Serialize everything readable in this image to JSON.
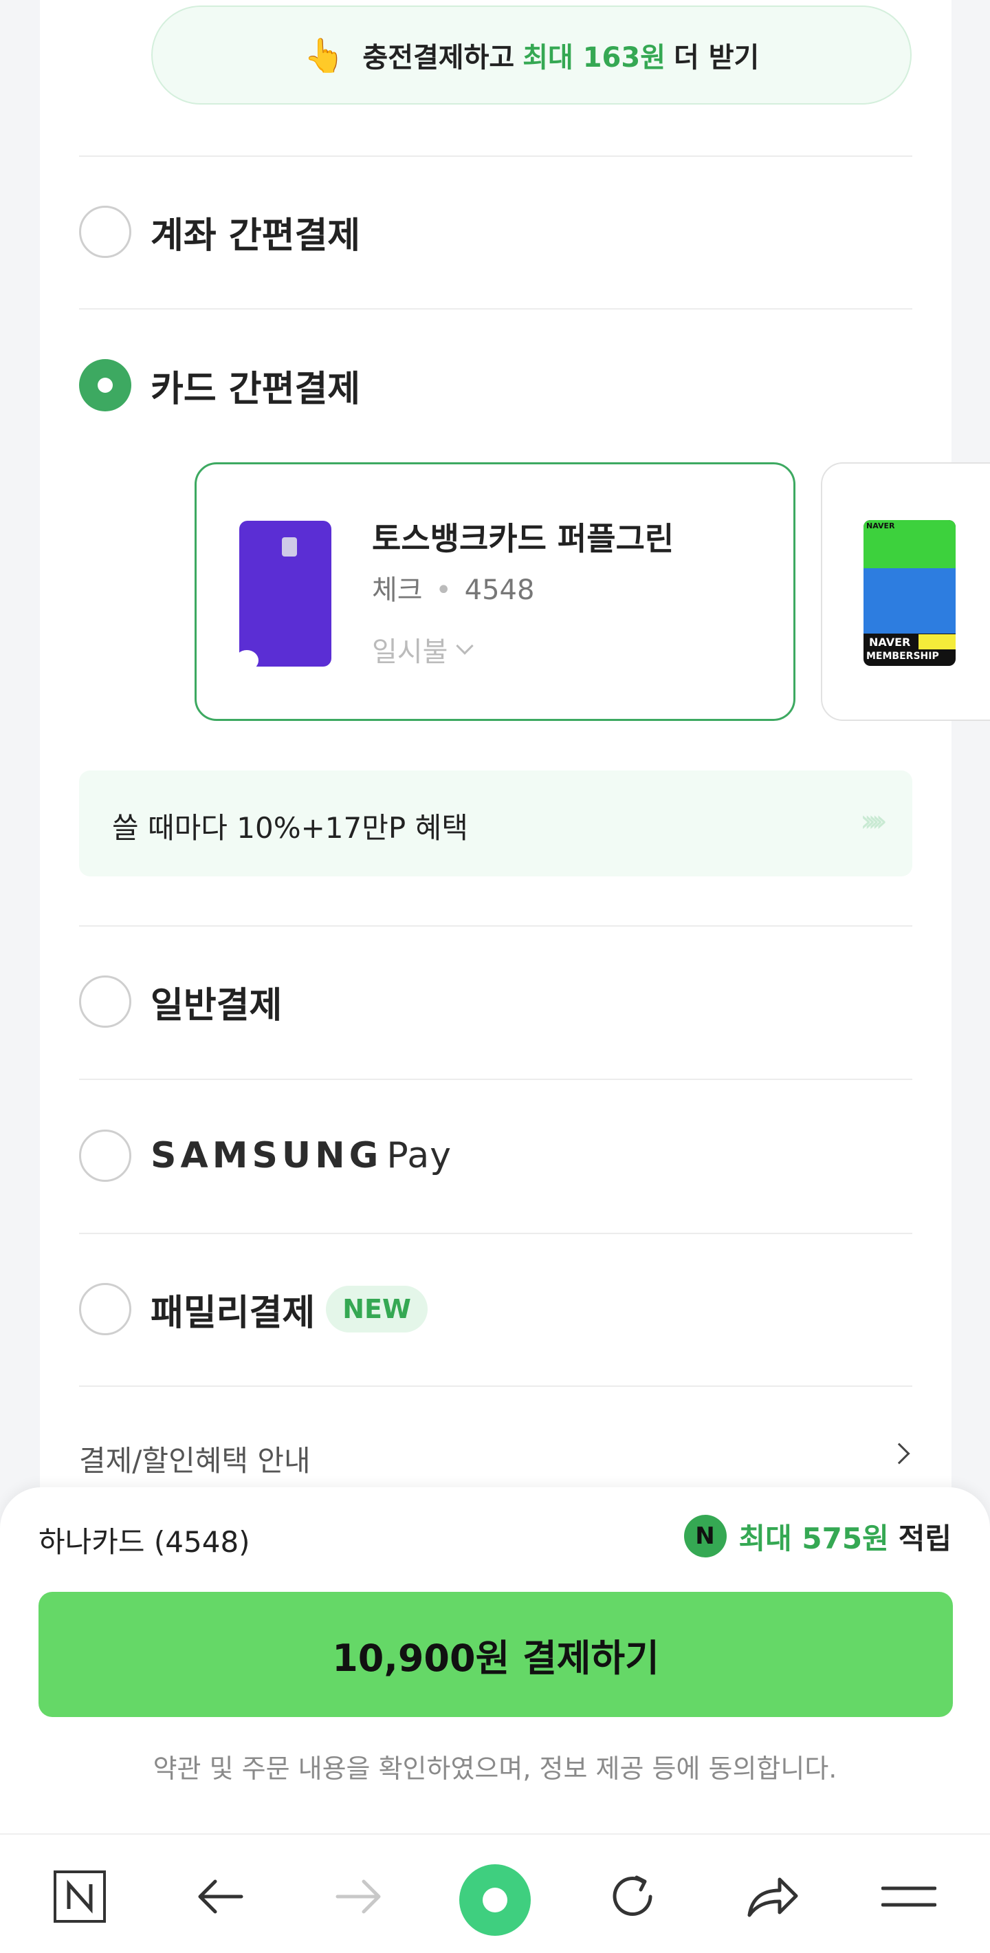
{
  "promo": {
    "hand_icon": "👆",
    "text_before": "충전결제하고",
    "text_highlight": "최대 163원",
    "text_after": "더 받기"
  },
  "payment_options": {
    "account": {
      "label": "계좌 간편결제",
      "selected": false
    },
    "card": {
      "label": "카드 간편결제",
      "selected": true
    },
    "general": {
      "label": "일반결제",
      "selected": false
    },
    "samsung": {
      "brand": "SAMSUNG",
      "pay": "Pay",
      "selected": false
    },
    "family": {
      "label": "패밀리결제",
      "badge": "NEW",
      "selected": false
    }
  },
  "selected_card": {
    "name": "토스뱅크카드 퍼플그린",
    "type": "체크",
    "separator": "•",
    "number": "4548",
    "installment": "일시불",
    "color": "#5b2ed4"
  },
  "next_card": {
    "brand_top": "NAVER",
    "brand_bottom": "NAVER",
    "plus": "PLUS",
    "membership": "MEMBERSHIP"
  },
  "benefit_banner": {
    "text": "쓸 때마다 10%+17만P 혜택",
    "arrows": "›››››"
  },
  "info": {
    "label": "결제/할인혜택 안내"
  },
  "summary": {
    "card_label": "하나카드 (4548)",
    "reward_icon": "N",
    "reward_amount": "최대 575원",
    "reward_suffix": "적립",
    "pay_button": "10,900원 결제하기",
    "agreement": "약관 및 주문 내용을 확인하였으며, 정보 제공 등에 동의합니다."
  },
  "browser_bar": {
    "items": [
      "naver-home-icon",
      "back-icon",
      "forward-icon",
      "green-dot-icon",
      "refresh-icon",
      "share-icon",
      "menu-icon"
    ]
  },
  "colors": {
    "accent_green": "#35a853",
    "button_green": "#65d867",
    "radio_selected": "#3da961"
  }
}
